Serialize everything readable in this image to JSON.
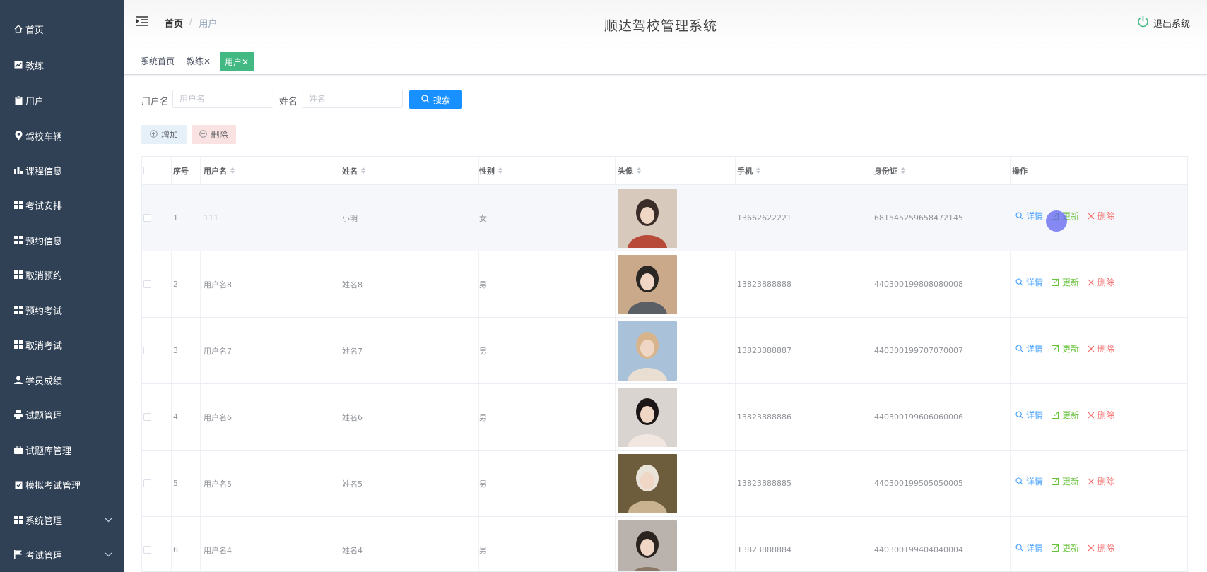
{
  "app": {
    "title": "顺达驾校管理系统",
    "logout_label": "退出系统"
  },
  "breadcrumb": {
    "home": "首页",
    "current": "用户"
  },
  "tags": [
    {
      "label": "系统首页"
    },
    {
      "label": "教练✕"
    },
    {
      "label": "用户✕",
      "active": true
    }
  ],
  "sidebar": {
    "items": [
      {
        "label": "首页",
        "icon": "home-icon"
      },
      {
        "label": "教练",
        "icon": "chart-icon"
      },
      {
        "label": "用户",
        "icon": "clipboard-icon"
      },
      {
        "label": "驾校车辆",
        "icon": "location-icon"
      },
      {
        "label": "课程信息",
        "icon": "bar-chart-icon"
      },
      {
        "label": "考试安排",
        "icon": "grid-icon"
      },
      {
        "label": "预约信息",
        "icon": "grid-icon"
      },
      {
        "label": "取消预约",
        "icon": "grid-icon"
      },
      {
        "label": "预约考试",
        "icon": "grid-icon"
      },
      {
        "label": "取消考试",
        "icon": "grid-icon"
      },
      {
        "label": "学员成绩",
        "icon": "user-icon"
      },
      {
        "label": "试题管理",
        "icon": "printer-icon"
      },
      {
        "label": "试题库管理",
        "icon": "briefcase-icon"
      },
      {
        "label": "模拟考试管理",
        "icon": "clipboard-check-icon"
      },
      {
        "label": "系统管理",
        "icon": "grid-icon",
        "expandable": true
      },
      {
        "label": "考试管理",
        "icon": "flag-icon",
        "expandable": true
      }
    ]
  },
  "search": {
    "username_label": "用户名",
    "username_placeholder": "用户名",
    "name_label": "姓名",
    "name_placeholder": "姓名",
    "search_button": "搜索"
  },
  "toolbar": {
    "add_label": "增加",
    "delete_label": "删除"
  },
  "table": {
    "headers": {
      "index": "序号",
      "username": "用户名",
      "name": "姓名",
      "gender": "性别",
      "avatar": "头像",
      "phone": "手机",
      "id_card": "身份证",
      "actions": "操作"
    },
    "action_labels": {
      "detail": "详情",
      "update": "更新",
      "delete": "删除"
    },
    "rows": [
      {
        "index": "1",
        "username": "111",
        "name": "小明",
        "gender": "女",
        "phone": "13662622221",
        "id_card": "681545259658472145"
      },
      {
        "index": "2",
        "username": "用户名8",
        "name": "姓名8",
        "gender": "男",
        "phone": "13823888888",
        "id_card": "440300199808080008"
      },
      {
        "index": "3",
        "username": "用户名7",
        "name": "姓名7",
        "gender": "男",
        "phone": "13823888887",
        "id_card": "440300199707070007"
      },
      {
        "index": "4",
        "username": "用户名6",
        "name": "姓名6",
        "gender": "男",
        "phone": "13823888886",
        "id_card": "440300199606060006"
      },
      {
        "index": "5",
        "username": "用户名5",
        "name": "姓名5",
        "gender": "男",
        "phone": "13823888885",
        "id_card": "440300199505050005"
      },
      {
        "index": "6",
        "username": "用户名4",
        "name": "姓名4",
        "gender": "男",
        "phone": "13823888884",
        "id_card": "440300199404040004"
      }
    ]
  },
  "colors": {
    "sidebar_bg": "#304156",
    "primary": "#1890ff",
    "tag_active": "#42b983",
    "detail": "#409eff",
    "update": "#67c23a",
    "delete": "#f56c6c"
  }
}
